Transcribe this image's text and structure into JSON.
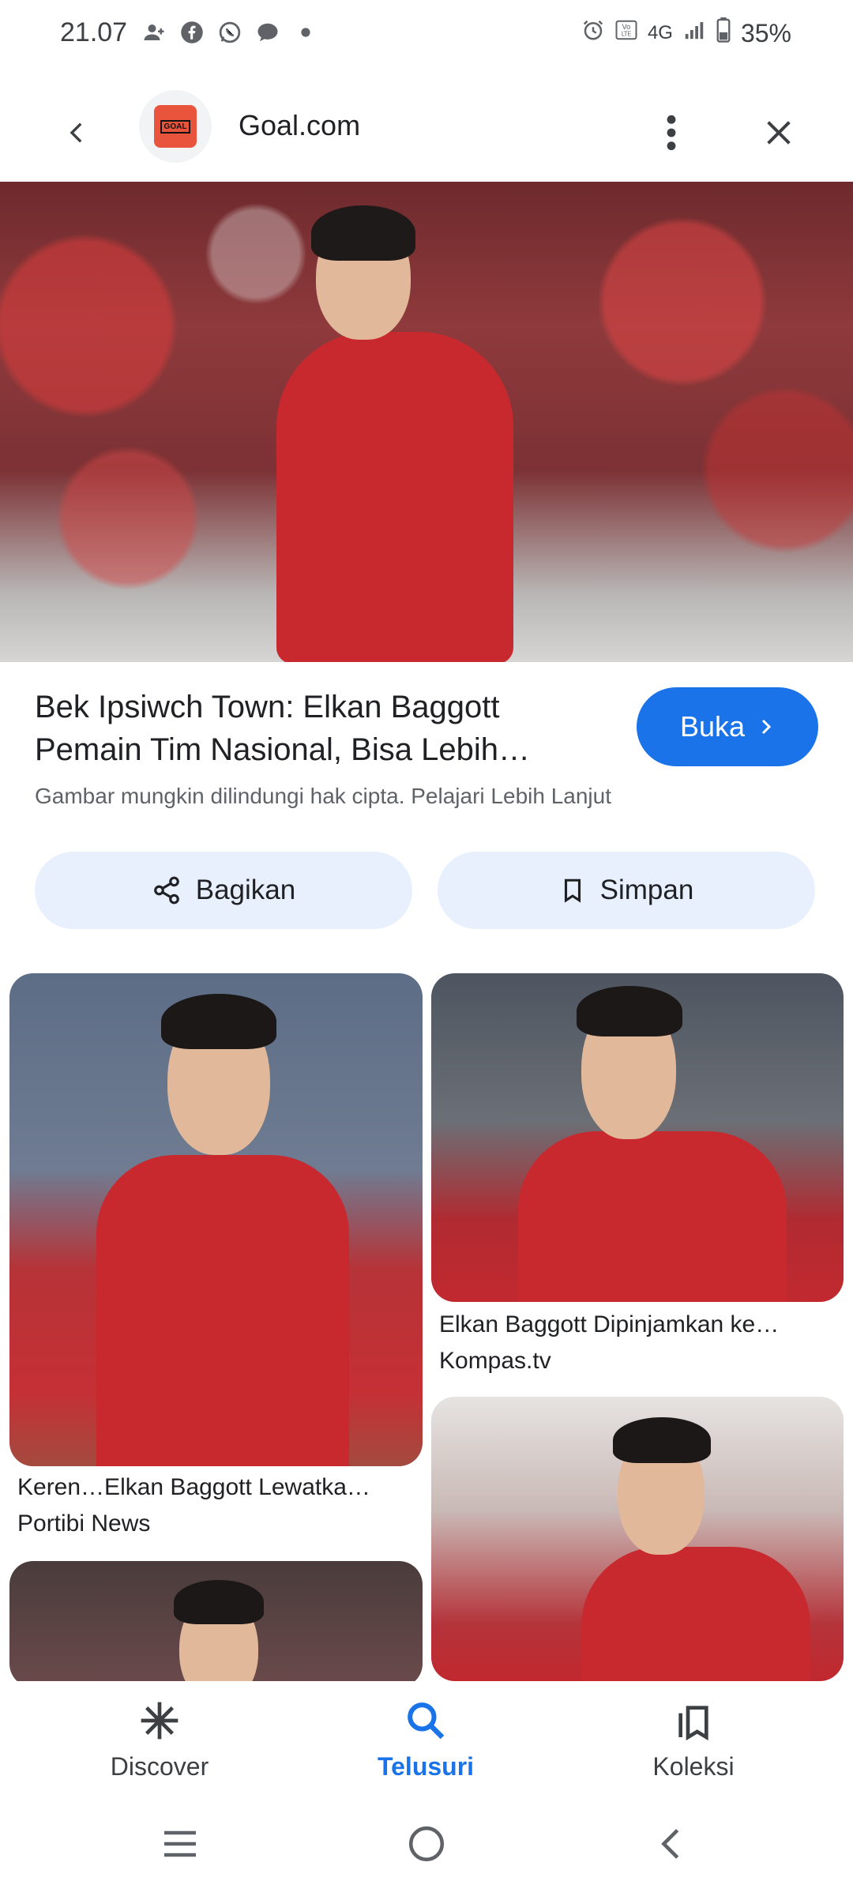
{
  "status_bar": {
    "time": "21.07",
    "battery": "35%",
    "network": "4G"
  },
  "header": {
    "site_name": "Goal.com",
    "logo_text": "GOAL"
  },
  "result": {
    "title": "Bek Ipsiwch Town: Elkan Baggott Pemain Tim Nasional, Bisa Lebih…",
    "open_label": "Buka",
    "copyright_note": "Gambar mungkin dilindungi hak cipta. Pelajari Lebih Lanjut",
    "share_label": "Bagikan",
    "save_label": "Simpan"
  },
  "related": [
    {
      "caption": "Keren…Elkan Baggott Lewatka…",
      "source": "Portibi News"
    },
    {
      "caption": "Elkan Baggott Dipinjamkan ke…",
      "source": "Kompas.tv"
    }
  ],
  "bottom_nav": {
    "discover": "Discover",
    "search": "Telusuri",
    "collections": "Koleksi"
  },
  "colors": {
    "accent": "#1a73e8",
    "chip_bg": "#e8f0fe"
  }
}
